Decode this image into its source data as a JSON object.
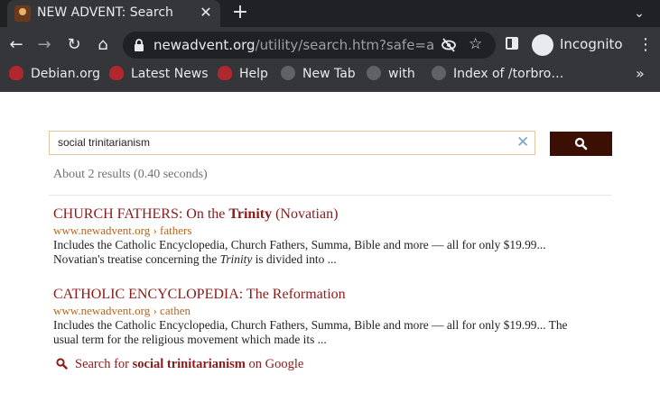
{
  "browser": {
    "tab": {
      "title": "NEW ADVENT: Search",
      "close": "✕"
    },
    "newtab": "+",
    "tabmenu": "⌄",
    "nav": {
      "back": "←",
      "forward": "→",
      "reload": "↻",
      "home": "⌂"
    },
    "url": {
      "host": "newadvent.org",
      "path": "/utility/search.htm?safe=a…"
    },
    "star": "☆",
    "incognito_label": "Incognito",
    "menu": "⋮",
    "bookmarks": [
      {
        "label": "Debian.org",
        "icon": "debian-icon"
      },
      {
        "label": "Latest News",
        "icon": "debian-icon"
      },
      {
        "label": "Help",
        "icon": "debian-icon"
      },
      {
        "label": "New Tab",
        "icon": "globe-icon"
      },
      {
        "label": "with",
        "icon": "globe-icon"
      },
      {
        "label": "Index of /torbro…",
        "icon": "globe-icon"
      }
    ],
    "bookmarks_more": "»",
    "colors": {
      "frame": "#202124",
      "toolbar": "#35363a",
      "text": "#e8eaed"
    }
  },
  "search": {
    "query": "social trinitarianism",
    "clear": "✕",
    "stats": "About 2 results (0.40 seconds)"
  },
  "results": [
    {
      "title_pre": "CHURCH FATHERS: On the ",
      "title_bold": "Trinity",
      "title_post": " (Novatian)",
      "url": "www.newadvent.org › fathers",
      "snippet_line1": "Includes the Catholic Encyclopedia, Church Fathers, Summa, Bible and more — all for only $19.99...",
      "snippet_line2_pre": "Novatian's treatise concerning the ",
      "snippet_line2_em": "Trinity",
      "snippet_line2_post": " is divided into ..."
    },
    {
      "title": "CATHOLIC ENCYCLOPEDIA: The Reformation",
      "url": "www.newadvent.org › cathen",
      "snippet_line1": "Includes the Catholic Encyclopedia, Church Fathers, Summa, Bible and more — all for only $19.99... The",
      "snippet_line2": "usual term for the religious movement which made its ..."
    }
  ],
  "google": {
    "pre": "Search for ",
    "bold": "social trinitarianism",
    "post": " on Google"
  },
  "colors": {
    "accent": "#3c0f05",
    "link": "#8b1a1a",
    "url": "#b5651d",
    "stats": "#707070"
  }
}
